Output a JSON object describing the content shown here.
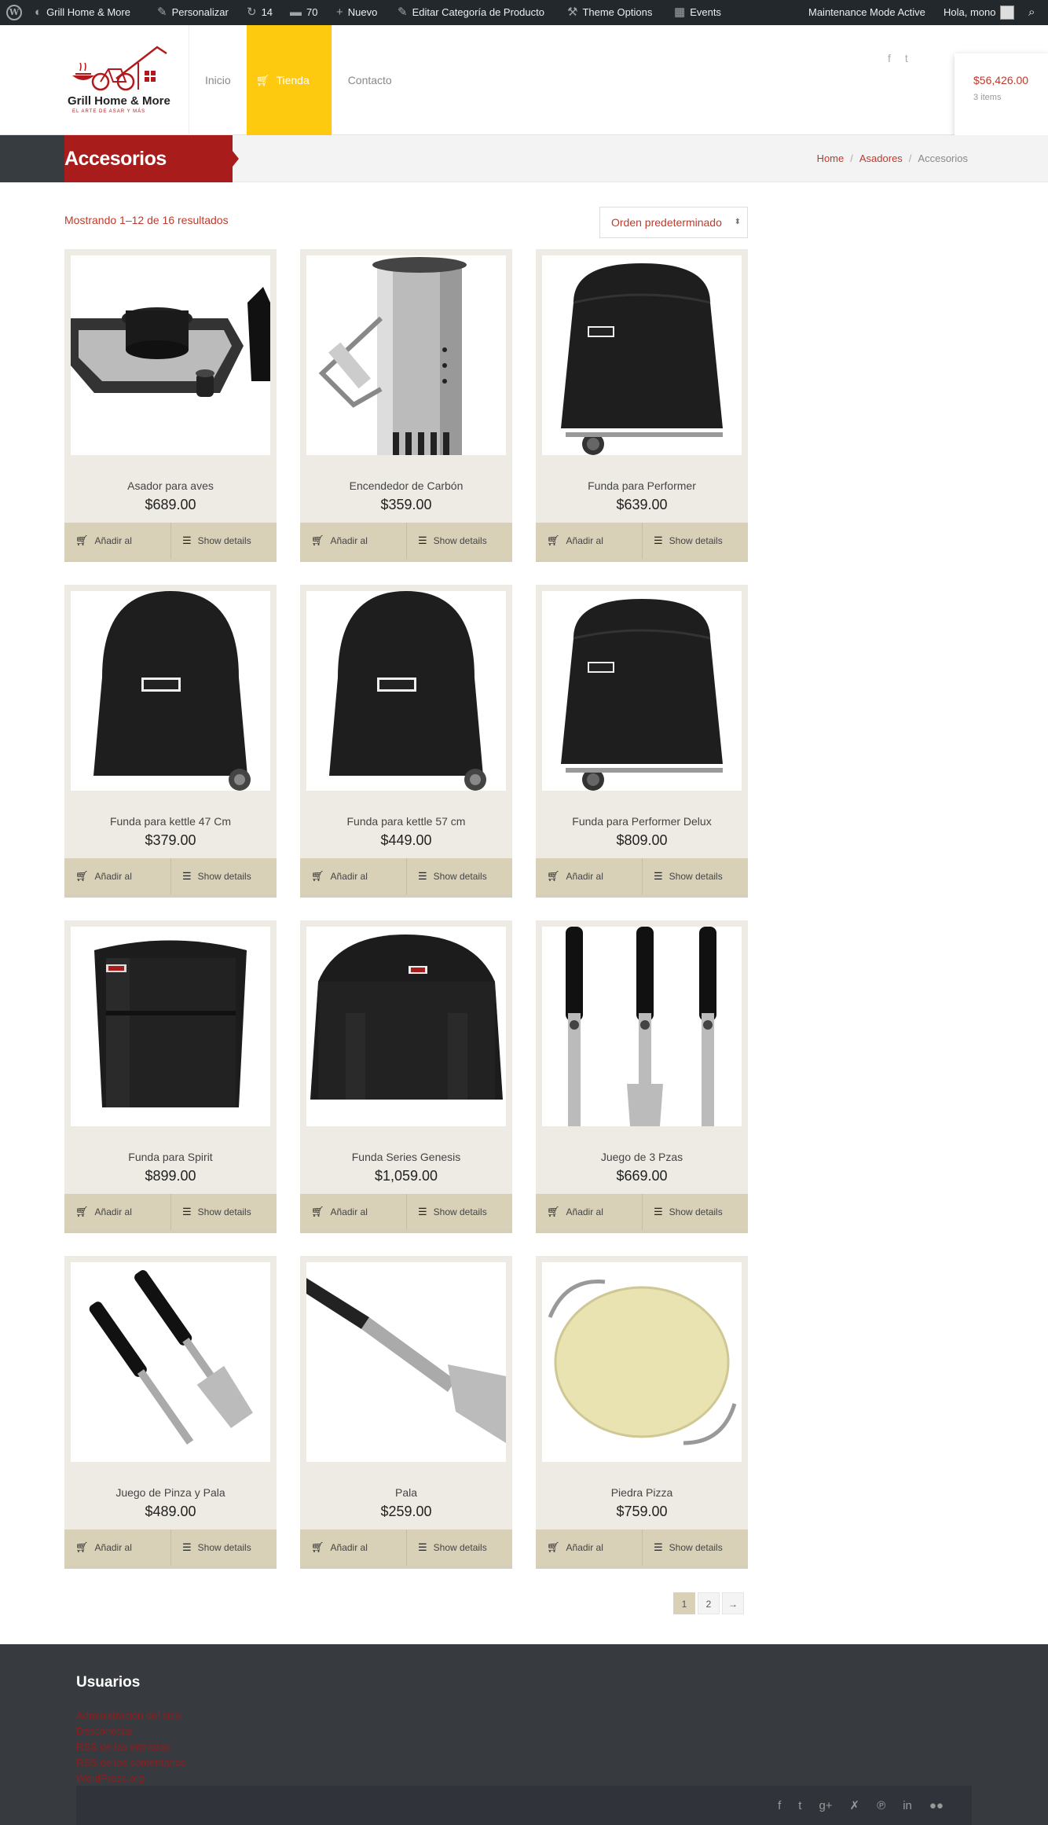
{
  "adminbar": {
    "site": "Grill Home & More",
    "customize": "Personalizar",
    "updates": "14",
    "comments": "70",
    "new": "Nuevo",
    "edit": "Editar Categoría de Producto",
    "theme_options": "Theme Options",
    "events": "Events",
    "maintenance": "Maintenance Mode Active",
    "greeting": "Hola, mono"
  },
  "logo": {
    "name": "Grill Home & More",
    "tagline": "EL ARTE DE ASAR Y MÁS"
  },
  "nav": [
    "Inicio",
    "Tienda",
    "Contacto"
  ],
  "cart": {
    "total": "$56,426.00",
    "items": "3 items"
  },
  "page": {
    "title": "Accesorios",
    "breadcrumb": [
      "Home",
      "Asadores",
      "Accesorios"
    ]
  },
  "shop": {
    "result_count": "Mostrando 1–12 de 16 resultados",
    "orderby": "Orden predeterminado"
  },
  "labels": {
    "add": "Añadir al",
    "details": "Show details"
  },
  "products": [
    {
      "name": "Asador para aves",
      "price": "$689.00",
      "image": "poultry-roaster"
    },
    {
      "name": "Encendedor de Carbón",
      "price": "$359.00",
      "image": "chimney-starter"
    },
    {
      "name": "Funda para Performer",
      "price": "$639.00",
      "image": "performer-cover"
    },
    {
      "name": "Funda para kettle 47 Cm",
      "price": "$379.00",
      "image": "kettle-cover"
    },
    {
      "name": "Funda para kettle 57 cm",
      "price": "$449.00",
      "image": "kettle-cover"
    },
    {
      "name": "Funda para Performer Delux",
      "price": "$809.00",
      "image": "performer-cover"
    },
    {
      "name": "Funda para Spirit",
      "price": "$899.00",
      "image": "spirit-cover"
    },
    {
      "name": "Funda Series Genesis",
      "price": "$1,059.00",
      "image": "genesis-cover"
    },
    {
      "name": "Juego de 3 Pzas",
      "price": "$669.00",
      "image": "tool-set"
    },
    {
      "name": "Juego de Pinza y Pala",
      "price": "$489.00",
      "image": "tongs-spatula"
    },
    {
      "name": "Pala",
      "price": "$259.00",
      "image": "spatula"
    },
    {
      "name": "Piedra Pizza",
      "price": "$759.00",
      "image": "pizza-stone"
    }
  ],
  "pagination": [
    "1",
    "2",
    "→"
  ],
  "footer": {
    "heading": "Usuarios",
    "links": [
      "Administración del sitio",
      "Desconectar",
      "RSS de las entradas",
      "RSS de los comentarios",
      "WordPress.org"
    ]
  },
  "colors": {
    "accent_red": "#a81c1c",
    "accent_yellow": "#fdca0f",
    "dark": "#373c40"
  }
}
